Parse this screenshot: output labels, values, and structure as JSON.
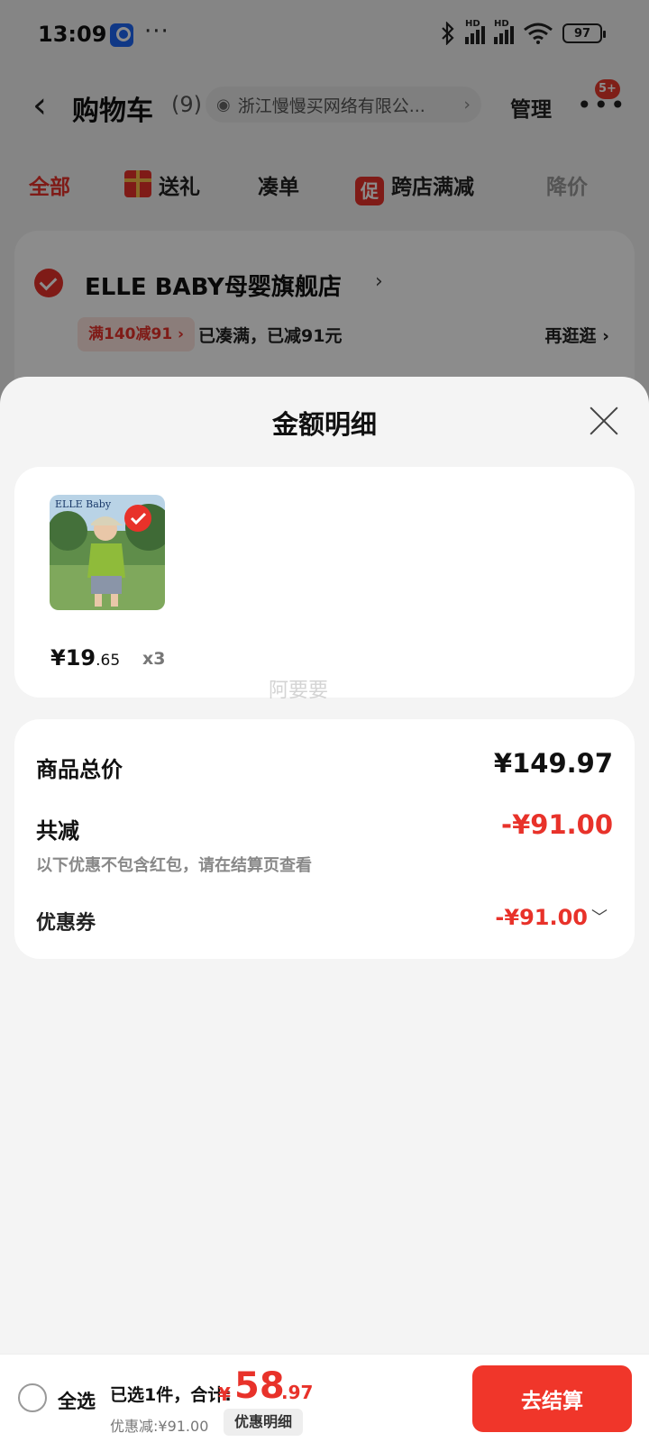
{
  "status_bar": {
    "time": "13:09",
    "dots": "···",
    "battery": "97",
    "signal_label": "HD",
    "icons": [
      "bluetooth-icon",
      "signal-icon",
      "wifi-icon",
      "battery-icon"
    ]
  },
  "header": {
    "title": "购物车",
    "count": "(9)",
    "shop_search": "浙江慢慢买网络有限公...",
    "manage": "管理",
    "more_badge": "5+"
  },
  "tabs": [
    {
      "label": "全部"
    },
    {
      "label": "送礼"
    },
    {
      "label": "凑单"
    },
    {
      "label": "跨店满减",
      "icon": "促"
    },
    {
      "label": "降价"
    }
  ],
  "store": {
    "name": "ELLE BABY母婴旗舰店",
    "promo_tag": "满140减91 ›",
    "promo_text": "已凑满，已减91元",
    "more": "再逛逛 ›"
  },
  "sheet": {
    "title": "金额明细",
    "product": {
      "price_int": "¥19",
      "price_dec": ".65",
      "qty": "x3",
      "brand_text": "ELLE Baby"
    },
    "watermark": "阿要要",
    "summary": {
      "total_label": "商品总价",
      "total_value": "¥149.97",
      "reduce_label": "共减",
      "reduce_value": "-¥91.00",
      "note": "以下优惠不包含红包，请在结算页查看",
      "coupon_label": "优惠券",
      "coupon_value": "-¥91.00"
    }
  },
  "bottom_bar": {
    "select_all": "全选",
    "selected_info": "已选1件，合计:",
    "total_symbol": "¥",
    "total_int": "58",
    "total_dec": ".97",
    "discount": "优惠减:¥91.00",
    "detail_button": "优惠明细",
    "checkout": "去结算"
  },
  "colors": {
    "accent": "#e8322a",
    "sheet_bg": "#f4f4f4",
    "card_bg": "#ffffff"
  }
}
